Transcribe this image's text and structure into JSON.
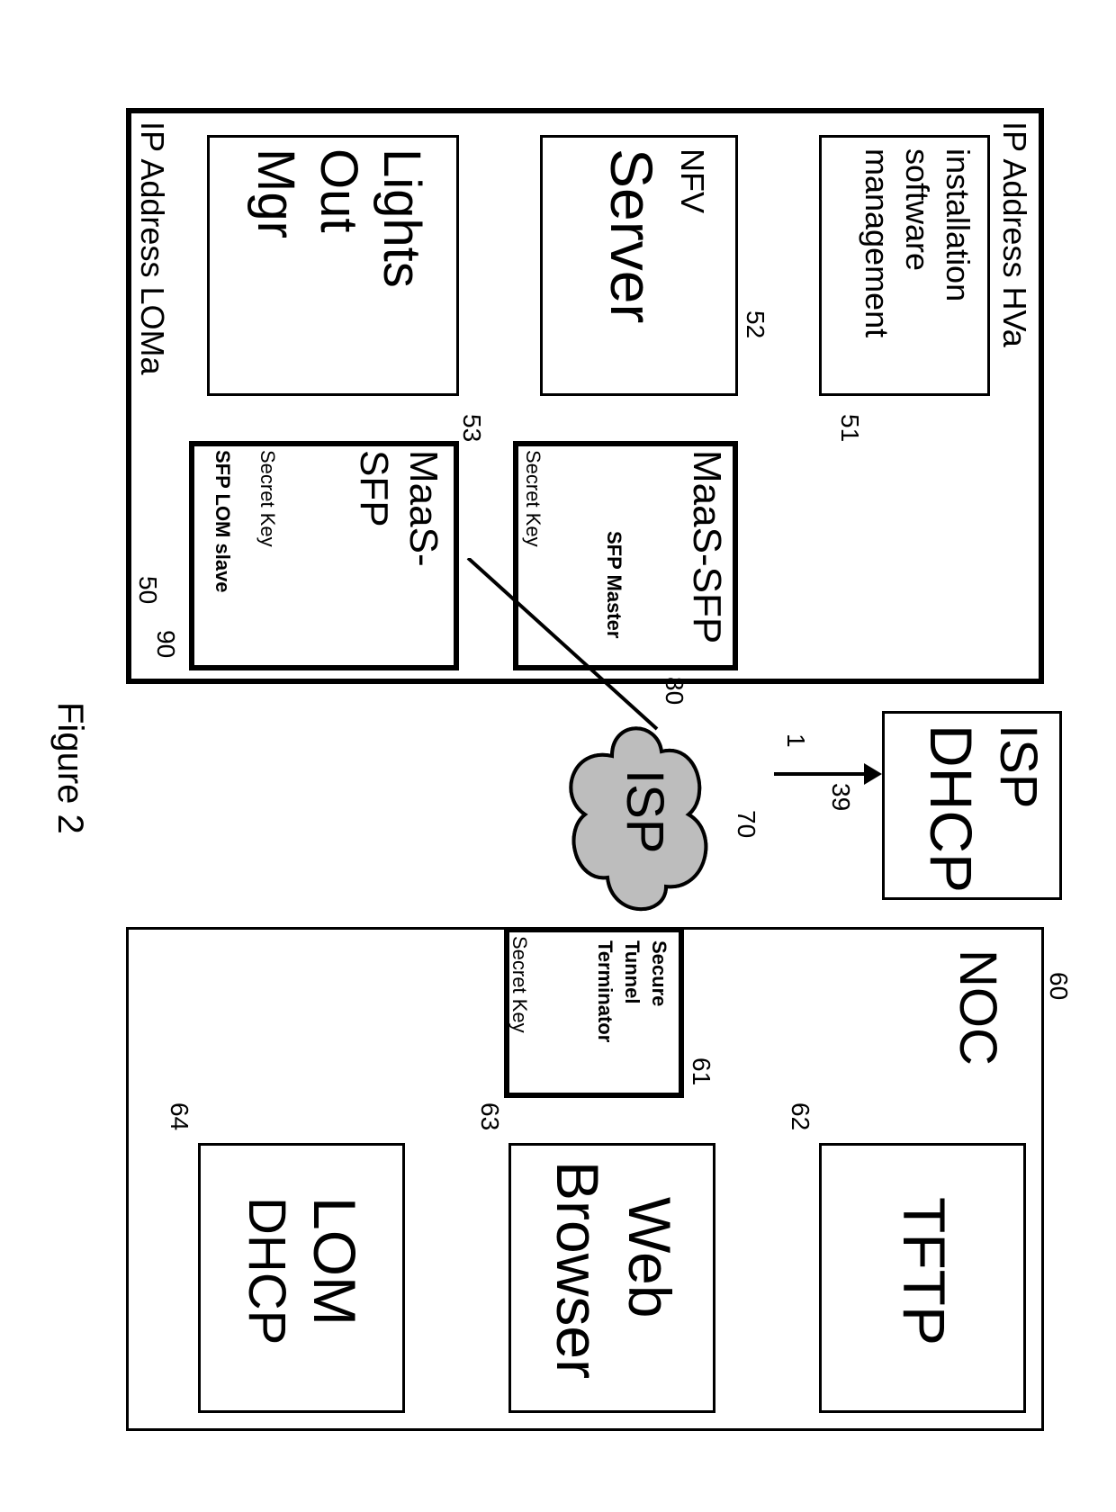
{
  "figure_label": "Figure 2",
  "left": {
    "outer_id": "50",
    "top_ip": "IP Address HVa",
    "bottom_ip": "IP Address LOMa",
    "install_box": {
      "id": "51",
      "line1": "installation",
      "line2": "software",
      "line3": "management"
    },
    "nfv_box": {
      "id": "52",
      "line1": "NFV",
      "line2": "Server"
    },
    "lights_box": {
      "id": "53",
      "line1": "Lights",
      "line2": "Out",
      "line3": "Mgr"
    },
    "sfp_top": {
      "id": "80",
      "title": "MaaS-SFP",
      "sub1": "SFP Master",
      "key": "Secret Key"
    },
    "sfp_bot": {
      "id": "90",
      "title1": "MaaS-",
      "title2": "SFP",
      "key": "Secret Key",
      "sub1": "SFP LOM slave"
    }
  },
  "middle": {
    "dhcp_box": {
      "line1": "ISP",
      "line2": "DHCP"
    },
    "cloud": {
      "label": "ISP",
      "id": "70"
    },
    "arrow": {
      "id": "39",
      "one": "1"
    }
  },
  "right": {
    "outer_id": "60",
    "noc": "NOC",
    "tftp": {
      "id": "62",
      "label": "TFTP"
    },
    "web": {
      "id": "63",
      "line1": "Web",
      "line2": "Browser"
    },
    "lom": {
      "id": "64",
      "line1": "LOM",
      "line2": "DHCP"
    },
    "stt": {
      "id": "61",
      "line1": "Secure",
      "line2": "Tunnel",
      "line3": "Terminator",
      "key": "Secret Key"
    }
  }
}
